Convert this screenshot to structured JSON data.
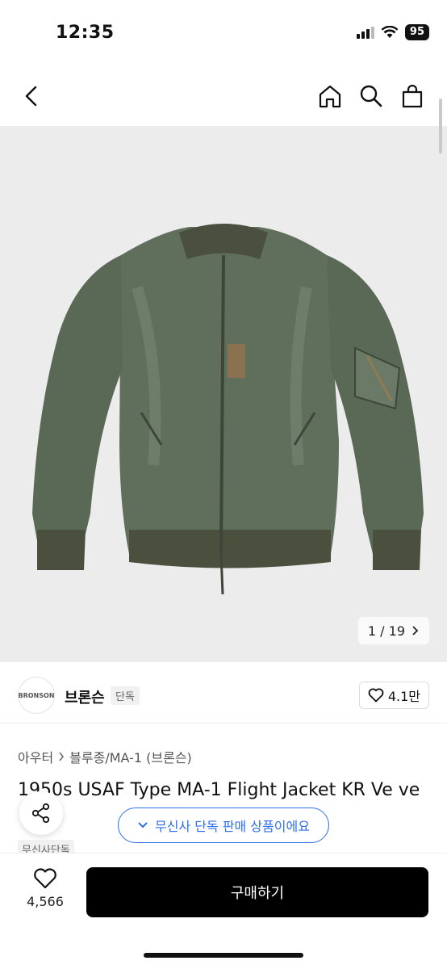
{
  "status_bar": {
    "time": "12:35",
    "battery": "95"
  },
  "nav": {
    "icons": [
      "back-icon",
      "home-icon",
      "search-icon",
      "cart-icon"
    ]
  },
  "gallery": {
    "counter": "1 / 19"
  },
  "brand": {
    "name": "브론슨",
    "tag": "단독",
    "logo_text": "BRONSON",
    "likes": "4.1만"
  },
  "breadcrumb": {
    "category": "아우터",
    "subcategory": "블루종/MA-1 (브론슨)"
  },
  "product": {
    "title": "1950s USAF Type MA-1 Flight Jacket KR Ve        ve",
    "badge": "무신사단독"
  },
  "notice": {
    "text": "무신사 단독 판매 상품이에요"
  },
  "bottom": {
    "wish_count": "4,566",
    "buy_label": "구매하기"
  },
  "colors": {
    "accent": "#2f6fed",
    "buy": "#000000",
    "jacket": "#5e6e5a"
  }
}
